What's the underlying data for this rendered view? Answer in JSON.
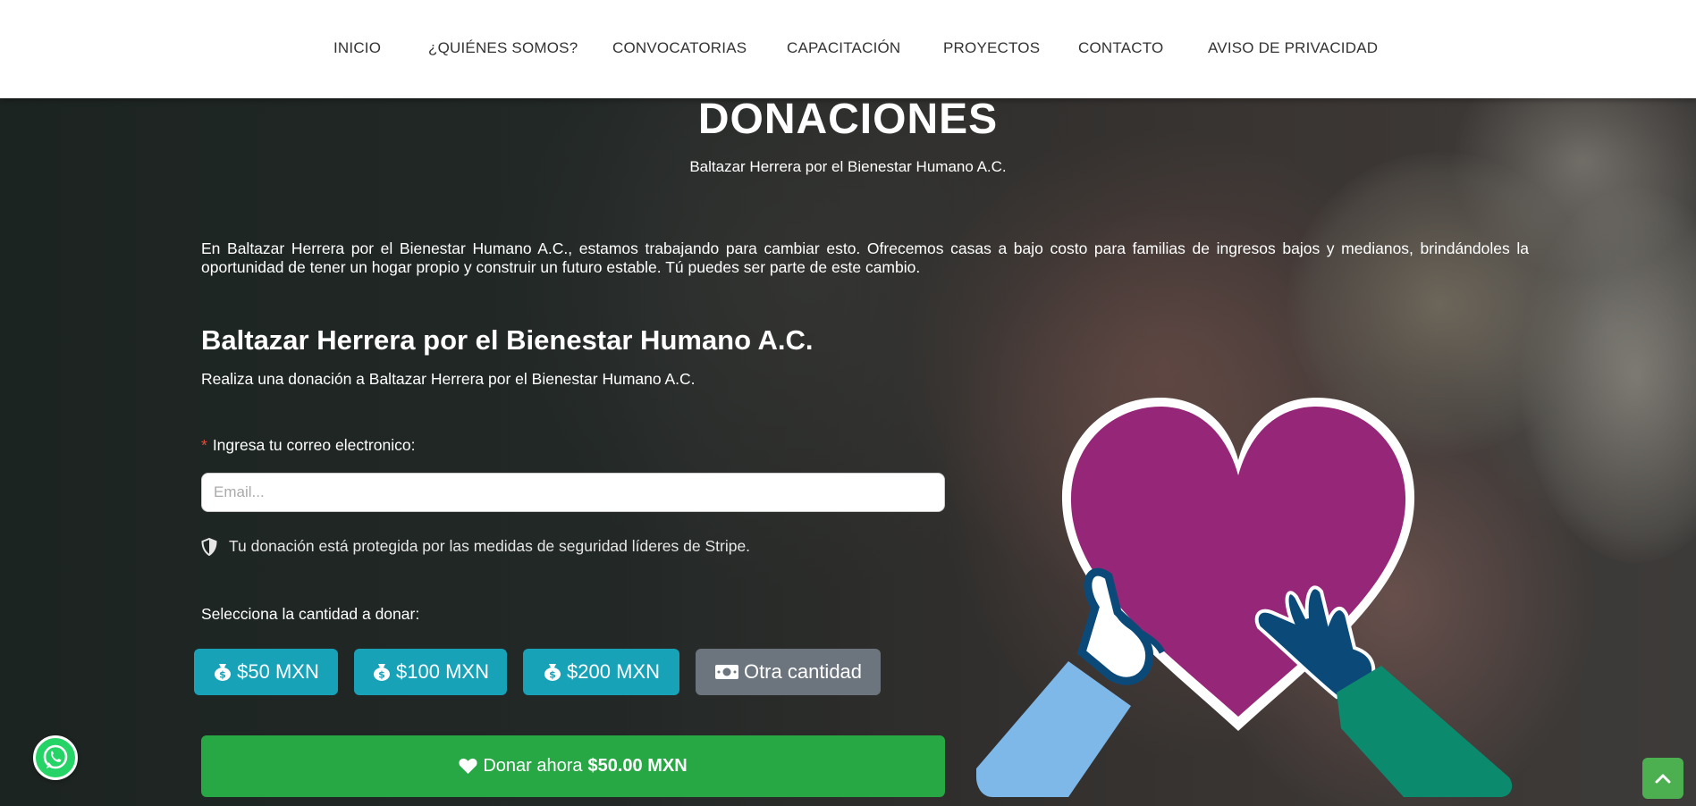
{
  "nav": {
    "items": [
      {
        "label": "INICIO"
      },
      {
        "label": "¿QUIÉNES SOMOS?"
      },
      {
        "label": "CONVOCATORIAS"
      },
      {
        "label": "CAPACITACIÓN"
      },
      {
        "label": "PROYECTOS"
      },
      {
        "label": "CONTACTO"
      },
      {
        "label": "AVISO DE PRIVACIDAD"
      }
    ]
  },
  "hero": {
    "title": "DONACIONES",
    "subtitle": "Baltazar Herrera por el Bienestar Humano A.C.",
    "description": "En Baltazar Herrera por el Bienestar Humano A.C., estamos trabajando para cambiar esto. Ofrecemos casas a bajo costo para familias de ingresos bajos y medianos, brindándoles la oportunidad de tener un hogar propio y construir un futuro estable. Tú puedes ser parte de este cambio."
  },
  "form": {
    "heading": "Baltazar Herrera por el Bienestar Humano A.C.",
    "intro": "Realiza una donación a Baltazar Herrera por el Bienestar Humano A.C.",
    "required_mark": "*",
    "email_label": "Ingresa tu correo electronico:",
    "email_placeholder": "Email...",
    "email_value": "",
    "security_note": "Tu donación está protegida por las medidas de seguridad líderes de Stripe.",
    "amount_label": "Selecciona la cantidad a donar:",
    "amounts": [
      {
        "label": "$50 MXN",
        "selected": true
      },
      {
        "label": "$100 MXN",
        "selected": false
      },
      {
        "label": "$200 MXN",
        "selected": false
      }
    ],
    "other_amount_label": "Otra cantidad",
    "donate_label": "Donar ahora",
    "donate_amount": "$50.00 MXN"
  },
  "colors": {
    "amount_button": "#17a2b8",
    "other_button": "#6c757d",
    "donate_button": "#28a745",
    "heart": "#962677",
    "whatsapp": "#25d366"
  },
  "icons": {
    "amount": "money-bag-icon",
    "other": "money-bill-icon",
    "donate": "heart-icon",
    "security": "shield-icon",
    "whatsapp": "whatsapp-icon",
    "back_to_top": "chevron-up-icon"
  }
}
